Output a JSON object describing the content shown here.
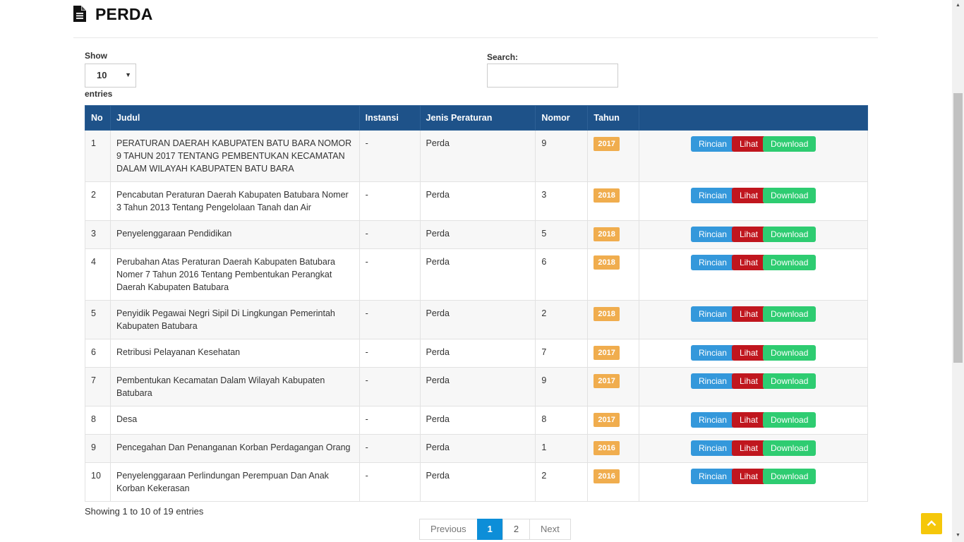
{
  "header": {
    "title": "PERDA"
  },
  "length": {
    "show_label": "Show",
    "value": "10",
    "entries_label": "entries"
  },
  "search": {
    "label": "Search:",
    "value": ""
  },
  "table": {
    "columns": [
      "No",
      "Judul",
      "Instansi",
      "Jenis Peraturan",
      "Nomor",
      "Tahun",
      ""
    ],
    "rows": [
      {
        "no": "1",
        "judul": "PERATURAN DAERAH KABUPATEN BATU BARA NOMOR 9 TAHUN 2017 TENTANG PEMBENTUKAN KECAMATAN DALAM WILAYAH KABUPATEN BATU BARA",
        "instansi": "-",
        "jenis": "Perda",
        "nomor": "9",
        "tahun": "2017"
      },
      {
        "no": "2",
        "judul": "Pencabutan Peraturan Daerah Kabupaten Batubara Nomer 3 Tahun 2013 Tentang Pengelolaan Tanah dan Air",
        "instansi": "-",
        "jenis": "Perda",
        "nomor": "3",
        "tahun": "2018"
      },
      {
        "no": "3",
        "judul": "Penyelenggaraan Pendidikan",
        "instansi": "-",
        "jenis": "Perda",
        "nomor": "5",
        "tahun": "2018"
      },
      {
        "no": "4",
        "judul": "Perubahan Atas Peraturan Daerah Kabupaten Batubara Nomer 7 Tahun 2016 Tentang Pembentukan Perangkat Daerah Kabupaten Batubara",
        "instansi": "-",
        "jenis": "Perda",
        "nomor": "6",
        "tahun": "2018"
      },
      {
        "no": "5",
        "judul": "Penyidik Pegawai Negri Sipil Di Lingkungan Pemerintah Kabupaten Batubara",
        "instansi": "-",
        "jenis": "Perda",
        "nomor": "2",
        "tahun": "2018"
      },
      {
        "no": "6",
        "judul": "Retribusi Pelayanan Kesehatan",
        "instansi": "-",
        "jenis": "Perda",
        "nomor": "7",
        "tahun": "2017"
      },
      {
        "no": "7",
        "judul": "Pembentukan Kecamatan Dalam Wilayah Kabupaten Batubara",
        "instansi": "-",
        "jenis": "Perda",
        "nomor": "9",
        "tahun": "2017"
      },
      {
        "no": "8",
        "judul": "Desa",
        "instansi": "-",
        "jenis": "Perda",
        "nomor": "8",
        "tahun": "2017"
      },
      {
        "no": "9",
        "judul": "Pencegahan Dan Penanganan Korban Perdagangan Orang",
        "instansi": "-",
        "jenis": "Perda",
        "nomor": "1",
        "tahun": "2016"
      },
      {
        "no": "10",
        "judul": "Penyelenggaraan Perlindungan Perempuan Dan Anak Korban Kekerasan",
        "instansi": "-",
        "jenis": "Perda",
        "nomor": "2",
        "tahun": "2016"
      }
    ],
    "actions": {
      "rincian": "Rincian",
      "lihat": "Lihat",
      "download": "Download"
    }
  },
  "info": "Showing 1 to 10 of 19 entries",
  "pagination": {
    "previous": "Previous",
    "pages": [
      "1",
      "2"
    ],
    "active": "1",
    "next": "Next"
  },
  "colors": {
    "header_bg": "#1e5289",
    "year_badge": "#f0ad4e",
    "rincian": "#3498db",
    "lihat": "#c0161e",
    "download": "#2ecc71",
    "active_page": "#0d8ed8",
    "to_top": "#f5c70a"
  },
  "icons": {
    "title_icon": "file-text-icon",
    "to_top_icon": "chevron-up-icon"
  }
}
